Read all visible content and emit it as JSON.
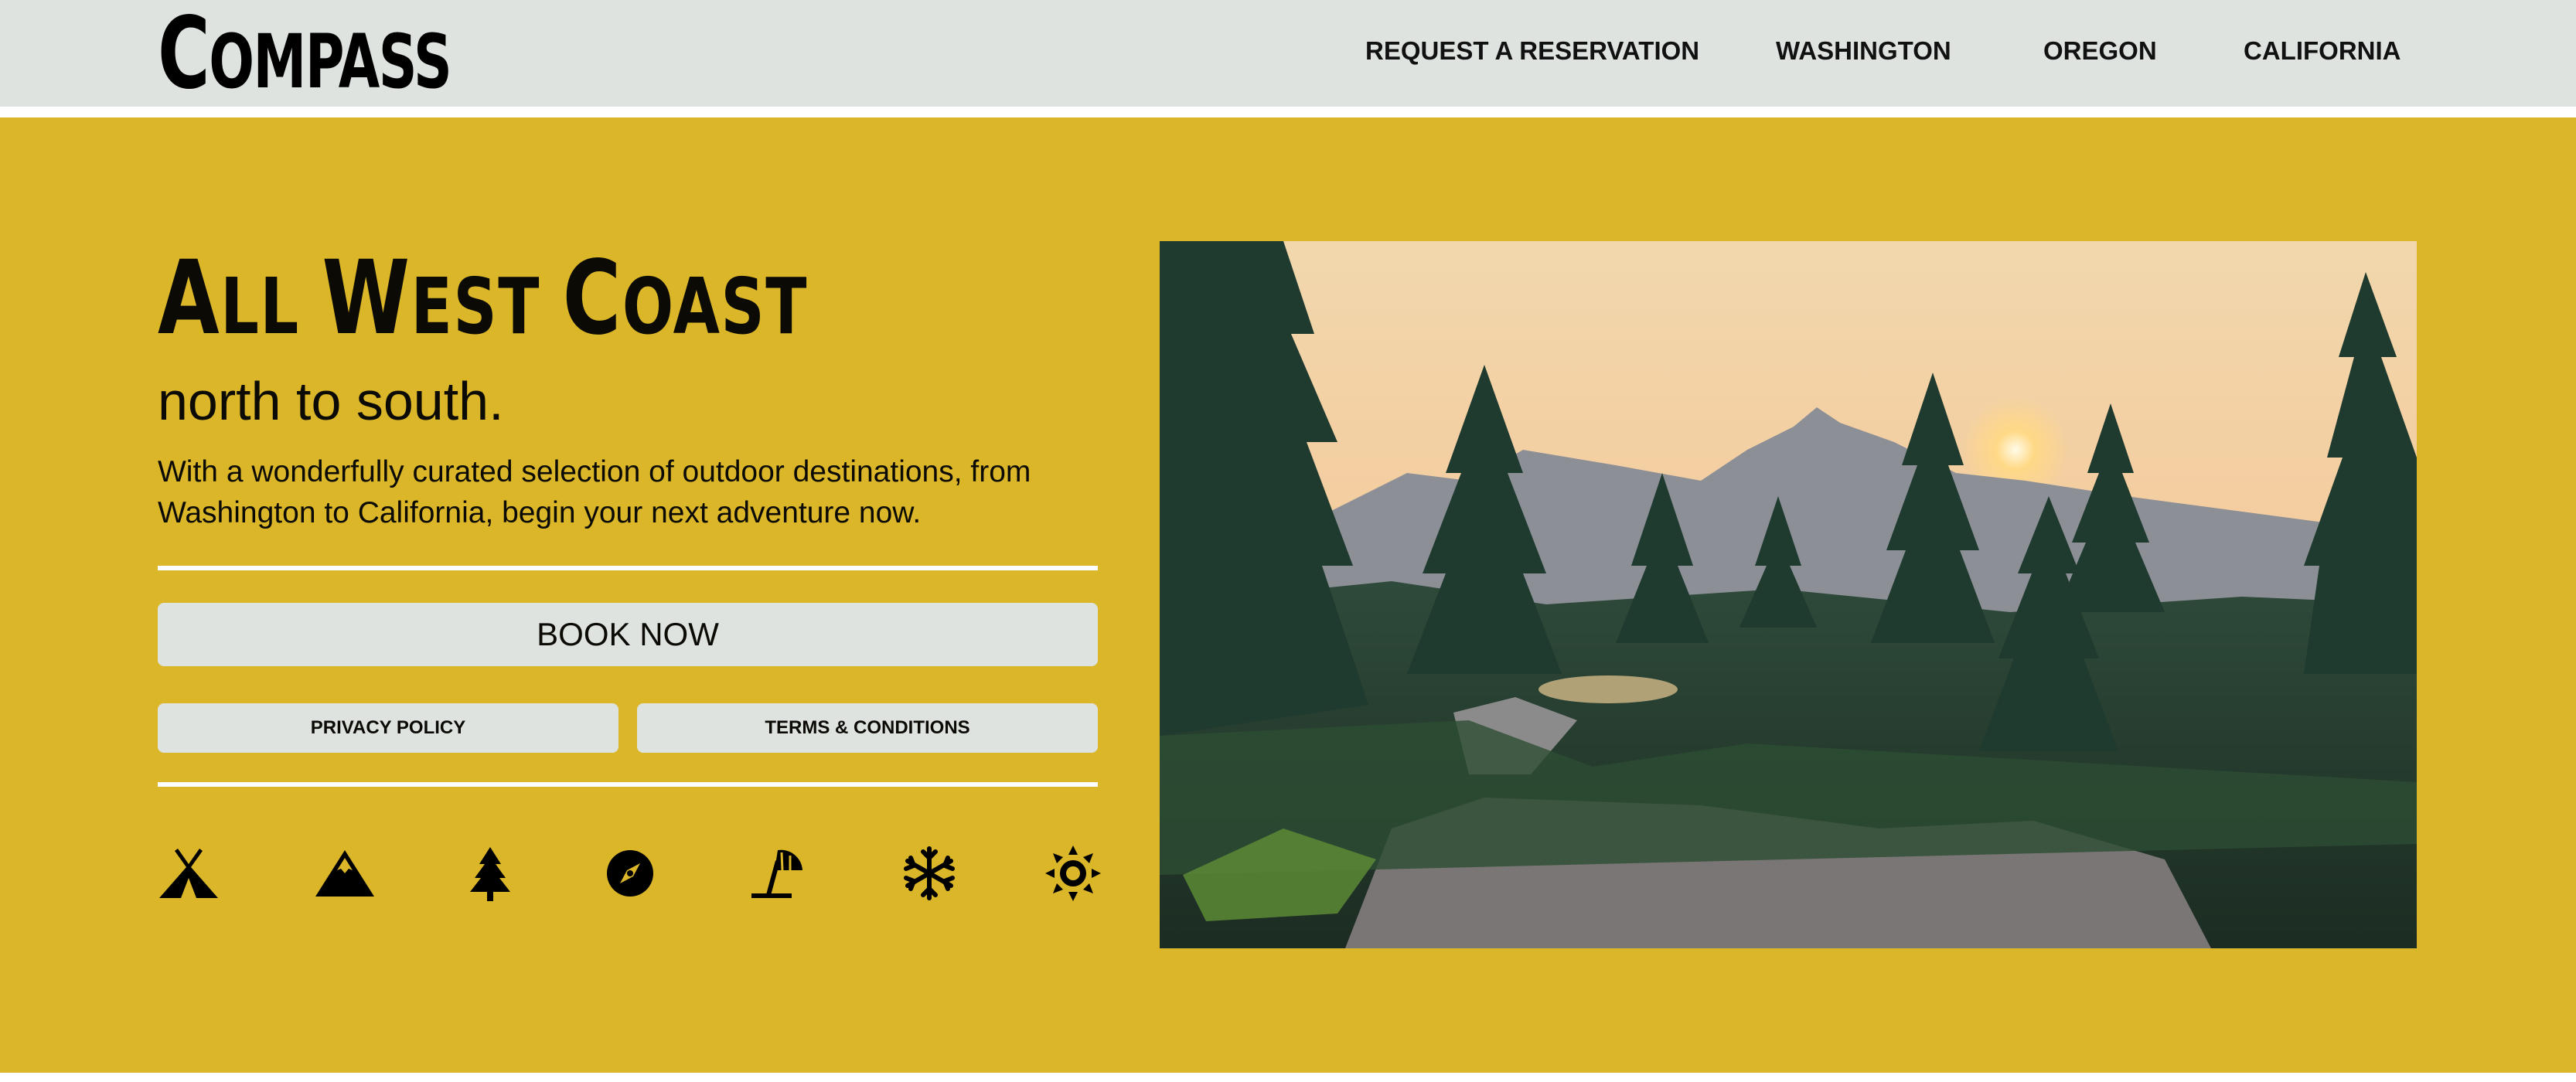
{
  "brand": {
    "logo_first": "C",
    "logo_rest": "OMPASS"
  },
  "nav": {
    "items": [
      {
        "label": "REQUEST A RESERVATION"
      },
      {
        "label": "WASHINGTON"
      },
      {
        "label": "OREGON"
      },
      {
        "label": "CALIFORNIA"
      }
    ]
  },
  "hero": {
    "headline": {
      "p1_cap": "A",
      "p1_rest": "LL ",
      "p2_cap": "W",
      "p2_rest": "EST ",
      "p3_cap": "C",
      "p3_rest": "OAST"
    },
    "subheadline": "north to south.",
    "description": "With a wonderfully curated selection of outdoor destinations, from Washington to California, begin your next adventure now.",
    "book_button": "BOOK NOW",
    "privacy_button": "PRIVACY POLICY",
    "terms_button": "TERMS & CONDITIONS",
    "icons": [
      "tent-icon",
      "mountain-icon",
      "tree-icon",
      "compass-icon",
      "beach-umbrella-icon",
      "snowflake-icon",
      "sun-icon"
    ]
  },
  "colors": {
    "header_bg": "#dee3e0",
    "hero_bg": "#dab628",
    "text": "#0b0a05",
    "button_bg": "#dee3e0"
  }
}
